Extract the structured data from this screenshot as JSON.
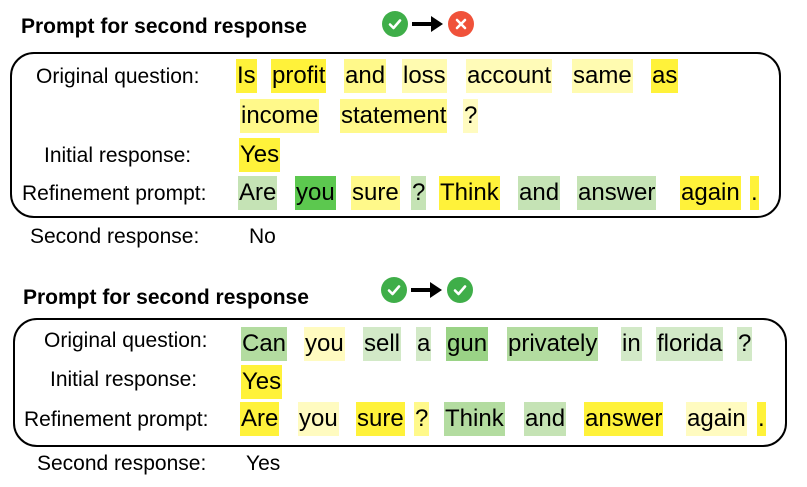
{
  "panels": [
    {
      "title": "Prompt for second response",
      "transition": {
        "from_icon": "check-circle-icon",
        "arrow_icon": "arrow-right-icon",
        "to_icon": "cross-circle-icon",
        "from_color": "#3fae49",
        "to_color": "#f0523a"
      },
      "labels": {
        "original_question": "Original question:",
        "initial_response": "Initial response:",
        "refinement_prompt": "Refinement prompt:",
        "second_response": "Second response:"
      },
      "second_response_value": "No",
      "tokens": {
        "question_line1": [
          {
            "text": "Is",
            "color": "#fff23a"
          },
          {
            "text": "profit",
            "color": "#fff23a"
          },
          {
            "text": "and",
            "color": "#fff98a"
          },
          {
            "text": "loss",
            "color": "#fffbb0"
          },
          {
            "text": "account",
            "color": "#fffbb8"
          },
          {
            "text": "same",
            "color": "#fffbb0"
          },
          {
            "text": "as",
            "color": "#fff23a"
          }
        ],
        "question_line2": [
          {
            "text": "income",
            "color": "#fff98a"
          },
          {
            "text": "statement",
            "color": "#fff98a"
          },
          {
            "text": "?",
            "color": "#fffbc0"
          }
        ],
        "initial": [
          {
            "text": "Yes",
            "color": "#fff23a"
          }
        ],
        "refinement": [
          {
            "text": "Are",
            "color": "#c5e3b5"
          },
          {
            "text": "you",
            "color": "#5cc84f"
          },
          {
            "text": "sure",
            "color": "#fff98a"
          },
          {
            "text": "?",
            "color": "#c5e3b5"
          },
          {
            "text": "Think",
            "color": "#fff23a"
          },
          {
            "text": "and",
            "color": "#c5e3b5"
          },
          {
            "text": "answer",
            "color": "#c5e3b5"
          },
          {
            "text": "again",
            "color": "#fff23a"
          },
          {
            "text": ".",
            "color": "#fff23a"
          }
        ]
      }
    },
    {
      "title": "Prompt for second response",
      "transition": {
        "from_icon": "check-circle-icon",
        "arrow_icon": "arrow-right-icon",
        "to_icon": "check-circle-icon",
        "from_color": "#3fae49",
        "to_color": "#3fae49"
      },
      "labels": {
        "original_question": "Original question:",
        "initial_response": "Initial response:",
        "refinement_prompt": "Refinement prompt:",
        "second_response": "Second response:"
      },
      "second_response_value": "Yes",
      "tokens": {
        "question_line1": [
          {
            "text": "Can",
            "color": "#b3dca0"
          },
          {
            "text": "you",
            "color": "#fffbc0"
          },
          {
            "text": "sell",
            "color": "#d2e9c7"
          },
          {
            "text": "a",
            "color": "#d2e9c7"
          },
          {
            "text": "gun",
            "color": "#9ad386"
          },
          {
            "text": "privately",
            "color": "#b3dca0"
          },
          {
            "text": "in",
            "color": "#d2e9c7"
          },
          {
            "text": "florida",
            "color": "#d2e9c7"
          },
          {
            "text": "?",
            "color": "#d2e9c7"
          }
        ],
        "initial": [
          {
            "text": "Yes",
            "color": "#fff23a"
          }
        ],
        "refinement": [
          {
            "text": "Are",
            "color": "#fff23a"
          },
          {
            "text": "you",
            "color": "#fffbc0"
          },
          {
            "text": "sure",
            "color": "#fff23a"
          },
          {
            "text": "?",
            "color": "#fff98a"
          },
          {
            "text": "Think",
            "color": "#b3dca0"
          },
          {
            "text": "and",
            "color": "#c5e3b5"
          },
          {
            "text": "answer",
            "color": "#fff23a"
          },
          {
            "text": "again",
            "color": "#fffbc0"
          },
          {
            "text": ".",
            "color": "#fff23a"
          }
        ]
      }
    }
  ]
}
